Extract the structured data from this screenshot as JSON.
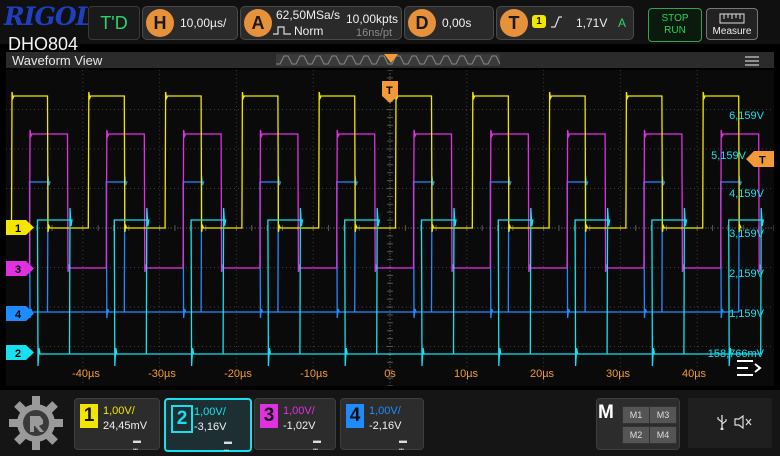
{
  "brand": {
    "logo": "RIGOL",
    "model": "DHO804"
  },
  "top": {
    "trigger_mode": "T'D",
    "horizontal": {
      "icon": "H",
      "value": "10,00µs/"
    },
    "acquire": {
      "icon": "A",
      "sample_rate": "62,50MSa/s",
      "mode": "Norm",
      "points": "10,00kpts",
      "per_point": "16ns/pt"
    },
    "delay": {
      "icon": "D",
      "value": "0,00s"
    },
    "trigger": {
      "icon": "T",
      "source": "1",
      "level": "1,71V",
      "coupling": "A"
    },
    "run_stop": {
      "stop": "STOP",
      "run": "RUN"
    },
    "measure": "Measure"
  },
  "view": {
    "title": "Waveform View"
  },
  "colors": {
    "ch1": "#f2e600",
    "ch2": "#18e0f0",
    "ch3": "#e030e0",
    "ch4": "#1e8cff",
    "orange": "#f29a3a"
  },
  "y_labels": [
    "6,159V",
    "5,159V",
    "4,159V",
    "3,159V",
    "2,159V",
    "1,159V",
    "158,766mV"
  ],
  "x_labels": [
    "-40µs",
    "-30µs",
    "-20µs",
    "-10µs",
    "0s",
    "10µs",
    "20µs",
    "30µs",
    "40µs"
  ],
  "markers": {
    "ch1": "1",
    "ch2": "2",
    "ch3": "3",
    "ch4": "4",
    "trig": "T",
    "level": "T"
  },
  "channels": [
    {
      "num": "1",
      "scale": "1,00V/",
      "offset": "24,45mV"
    },
    {
      "num": "2",
      "scale": "1,00V/",
      "offset": "-3,16V"
    },
    {
      "num": "3",
      "scale": "1,00V/",
      "offset": "-1,02V"
    },
    {
      "num": "4",
      "scale": "1,00V/",
      "offset": "-2,16V"
    }
  ],
  "math": {
    "label": "M",
    "m1": "M1",
    "m2": "M2",
    "m3": "M3",
    "m4": "M4"
  },
  "icons": {
    "usb": "usb-icon",
    "sound": "sound-mute-icon",
    "menu": "hamburger-menu-icon",
    "home": "gear-home-icon"
  }
}
